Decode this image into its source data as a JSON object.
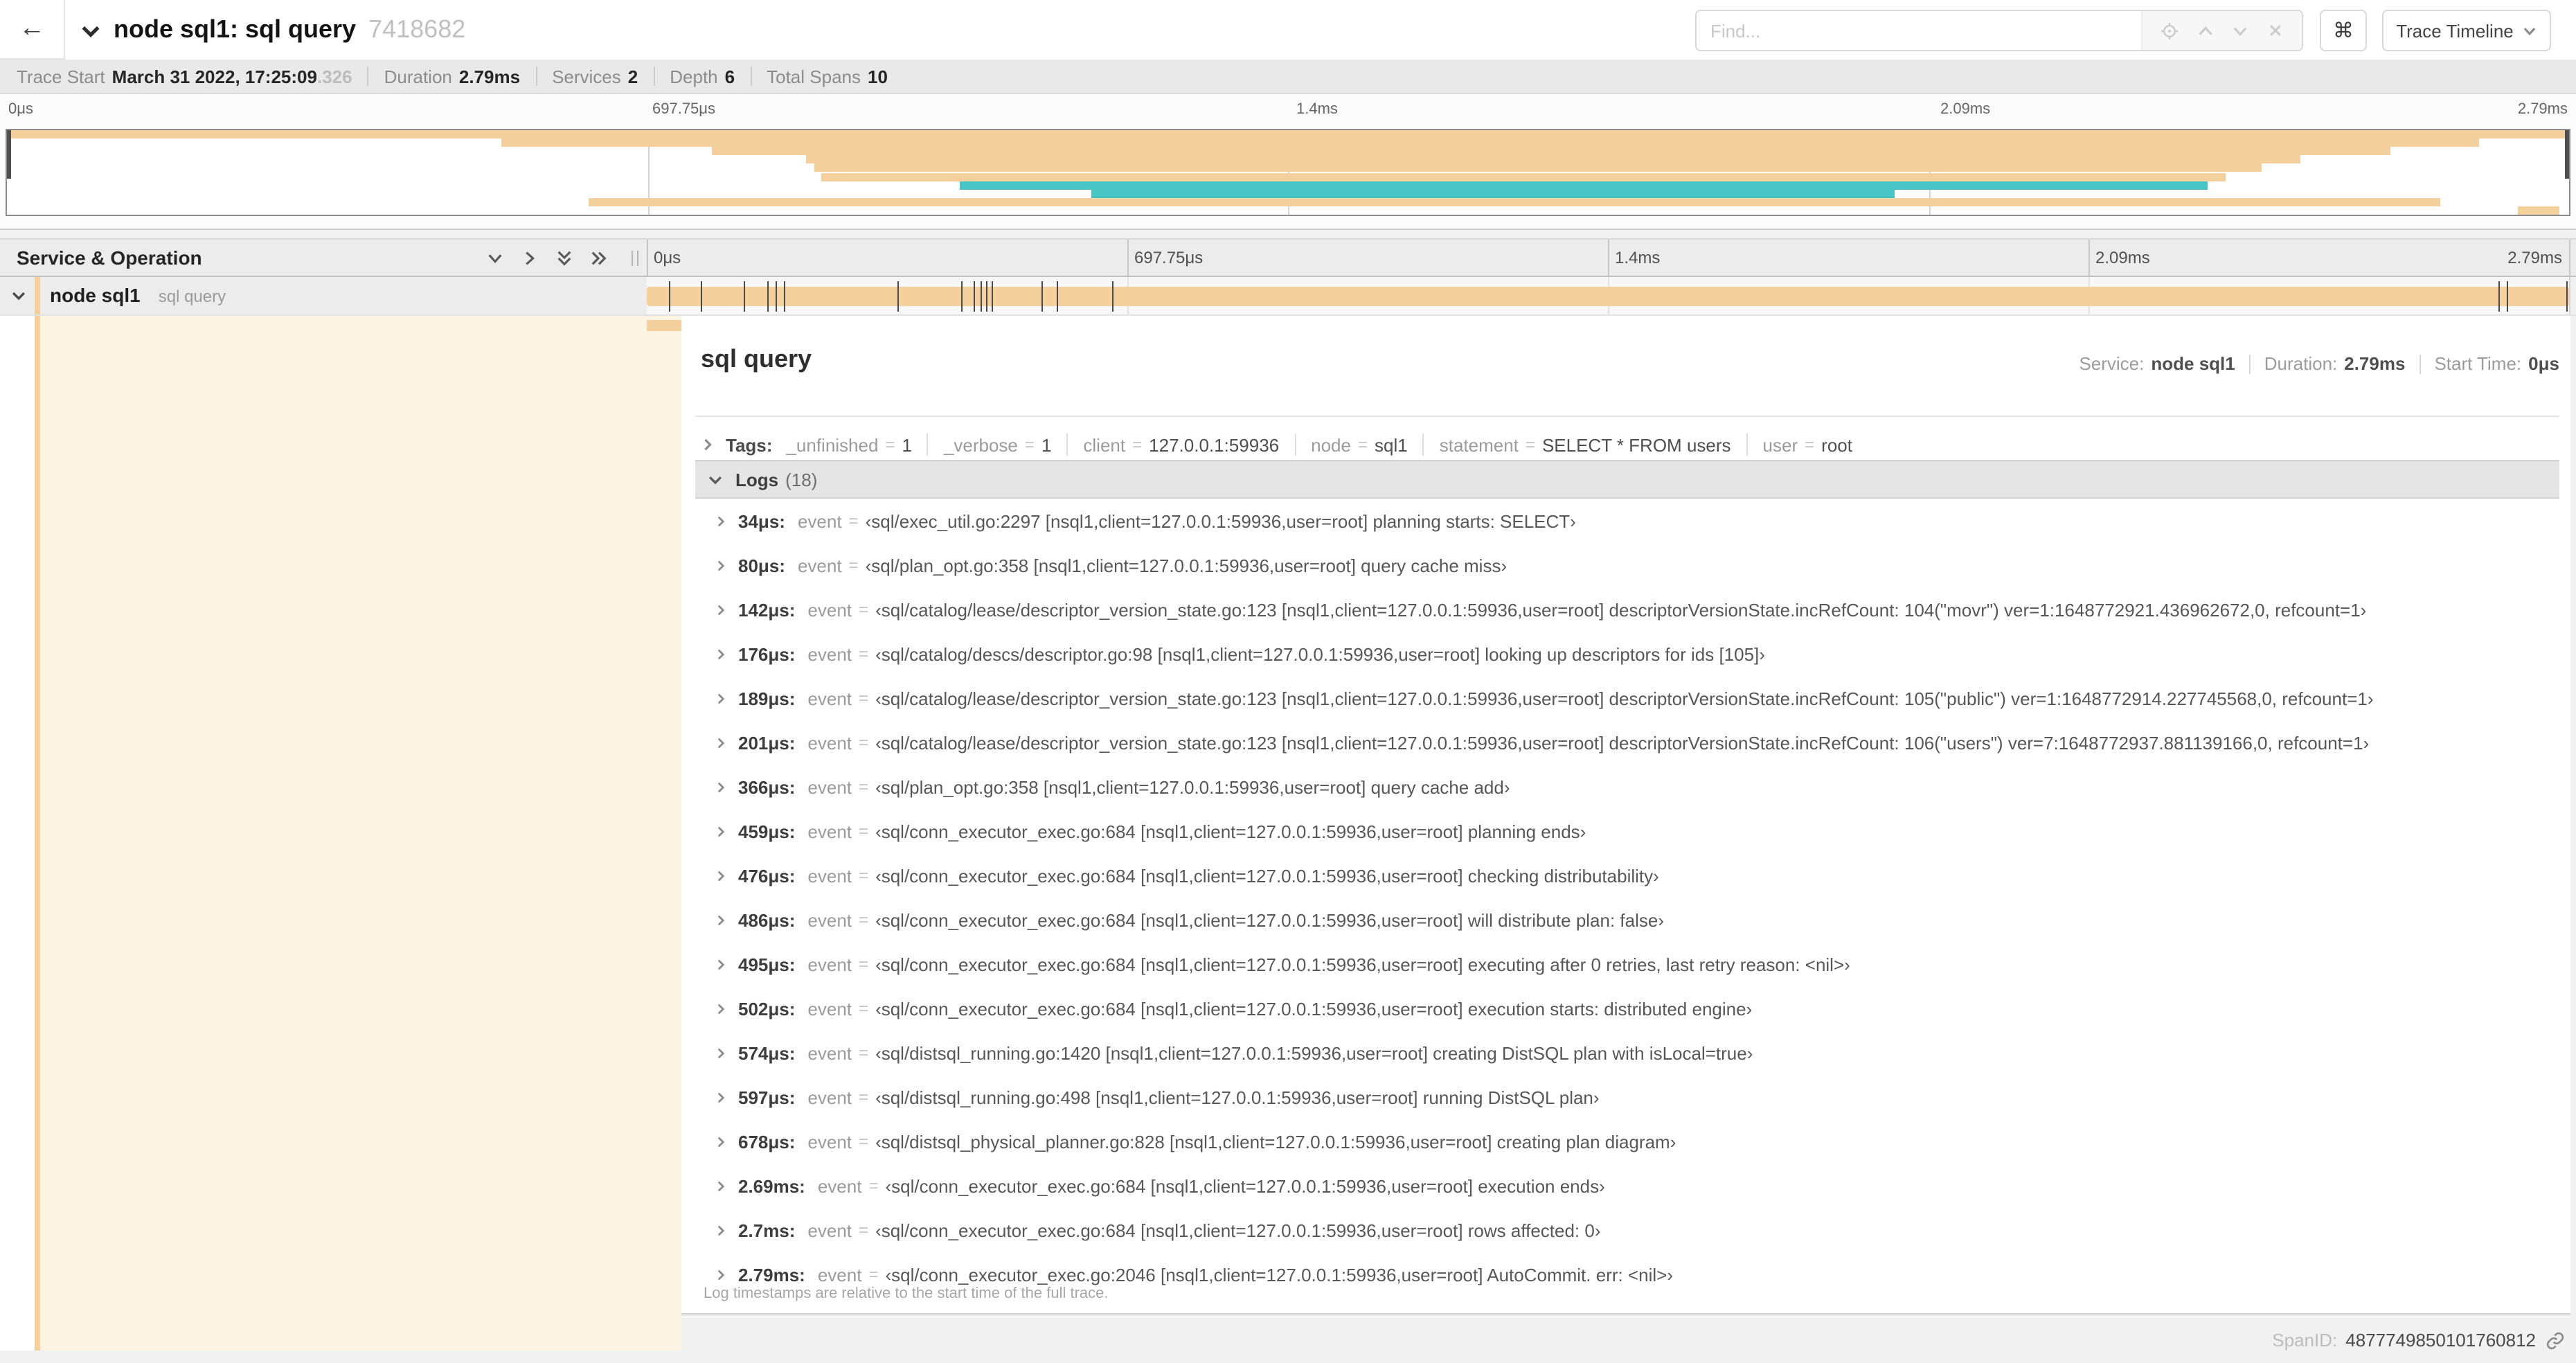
{
  "header": {
    "back_icon": "←",
    "title": "node sql1: sql query",
    "trace_id": "7418682",
    "find_placeholder": "Find...",
    "kbd_icon": "⌘",
    "view_select_label": "Trace Timeline"
  },
  "summary": {
    "items": [
      {
        "label": "Trace Start",
        "value": "March 31 2022, 17:25:09",
        "suffix": ".326"
      },
      {
        "label": "Duration",
        "value": "2.79ms"
      },
      {
        "label": "Services",
        "value": "2"
      },
      {
        "label": "Depth",
        "value": "6"
      },
      {
        "label": "Total Spans",
        "value": "10"
      }
    ]
  },
  "colors": {
    "tan": "#f4d19c",
    "teal": "#49c4c4",
    "cream": "#fcf4e3"
  },
  "timeline": {
    "left_header": "Service & Operation",
    "ticks": [
      "0μs",
      "697.75μs",
      "1.4ms",
      "2.09ms",
      "2.79ms"
    ],
    "tick_pcts": [
      0,
      25,
      50,
      75,
      100
    ],
    "row": {
      "service": "node sql1",
      "operation": "sql query",
      "bar_start_pct": 0,
      "bar_end_pct": 100,
      "log_marker_pcts": [
        1.22,
        2.87,
        5.09,
        6.31,
        6.77,
        7.2,
        13.12,
        16.45,
        17.06,
        17.42,
        17.74,
        17.99,
        20.57,
        21.4,
        24.3,
        96.4,
        96.8,
        99.9
      ]
    }
  },
  "minimap": {
    "rows": [
      {
        "start": 0,
        "end": 100,
        "color": "tan"
      },
      {
        "start": 19.3,
        "end": 96.5,
        "color": "tan"
      },
      {
        "start": 27.5,
        "end": 93.0,
        "color": "tan"
      },
      {
        "start": 31.2,
        "end": 89.5,
        "color": "tan"
      },
      {
        "start": 31.5,
        "end": 88.0,
        "color": "tan"
      },
      {
        "start": 31.8,
        "end": 86.6,
        "color": "tan"
      },
      {
        "start": 37.2,
        "end": 85.9,
        "color": "teal"
      },
      {
        "start": 42.3,
        "end": 73.7,
        "color": "teal"
      },
      {
        "start": 22.7,
        "end": 95.0,
        "color": "tan"
      },
      {
        "start": 98.0,
        "end": 99.6,
        "color": "tan"
      }
    ]
  },
  "detail": {
    "title": "sql query",
    "meta": [
      {
        "label": "Service:",
        "value": "node sql1"
      },
      {
        "label": "Duration:",
        "value": "2.79ms"
      },
      {
        "label": "Start Time:",
        "value": "0μs"
      }
    ],
    "tags_label": "Tags:",
    "tags": [
      {
        "key": "_unfinished",
        "value": "1"
      },
      {
        "key": "_verbose",
        "value": "1"
      },
      {
        "key": "client",
        "value": "127.0.0.1:59936"
      },
      {
        "key": "node",
        "value": "sql1"
      },
      {
        "key": "statement",
        "value": "SELECT * FROM users"
      },
      {
        "key": "user",
        "value": "root"
      }
    ],
    "logs_label": "Logs",
    "logs_count": "(18)",
    "logs": [
      {
        "time": "34μs:",
        "key": "event",
        "value": "‹sql/exec_util.go:2297 [nsql1,client=127.0.0.1:59936,user=root] planning starts: SELECT›"
      },
      {
        "time": "80μs:",
        "key": "event",
        "value": "‹sql/plan_opt.go:358 [nsql1,client=127.0.0.1:59936,user=root] query cache miss›"
      },
      {
        "time": "142μs:",
        "key": "event",
        "value": "‹sql/catalog/lease/descriptor_version_state.go:123 [nsql1,client=127.0.0.1:59936,user=root] descriptorVersionState.incRefCount: 104(\"movr\") ver=1:1648772921.436962672,0, refcount=1›"
      },
      {
        "time": "176μs:",
        "key": "event",
        "value": "‹sql/catalog/descs/descriptor.go:98 [nsql1,client=127.0.0.1:59936,user=root] looking up descriptors for ids [105]›"
      },
      {
        "time": "189μs:",
        "key": "event",
        "value": "‹sql/catalog/lease/descriptor_version_state.go:123 [nsql1,client=127.0.0.1:59936,user=root] descriptorVersionState.incRefCount: 105(\"public\") ver=1:1648772914.227745568,0, refcount=1›"
      },
      {
        "time": "201μs:",
        "key": "event",
        "value": "‹sql/catalog/lease/descriptor_version_state.go:123 [nsql1,client=127.0.0.1:59936,user=root] descriptorVersionState.incRefCount: 106(\"users\") ver=7:1648772937.881139166,0, refcount=1›"
      },
      {
        "time": "366μs:",
        "key": "event",
        "value": "‹sql/plan_opt.go:358 [nsql1,client=127.0.0.1:59936,user=root] query cache add›"
      },
      {
        "time": "459μs:",
        "key": "event",
        "value": "‹sql/conn_executor_exec.go:684 [nsql1,client=127.0.0.1:59936,user=root] planning ends›"
      },
      {
        "time": "476μs:",
        "key": "event",
        "value": "‹sql/conn_executor_exec.go:684 [nsql1,client=127.0.0.1:59936,user=root] checking distributability›"
      },
      {
        "time": "486μs:",
        "key": "event",
        "value": "‹sql/conn_executor_exec.go:684 [nsql1,client=127.0.0.1:59936,user=root] will distribute plan: false›"
      },
      {
        "time": "495μs:",
        "key": "event",
        "value": "‹sql/conn_executor_exec.go:684 [nsql1,client=127.0.0.1:59936,user=root] executing after 0 retries, last retry reason: <nil>›"
      },
      {
        "time": "502μs:",
        "key": "event",
        "value": "‹sql/conn_executor_exec.go:684 [nsql1,client=127.0.0.1:59936,user=root] execution starts: distributed engine›"
      },
      {
        "time": "574μs:",
        "key": "event",
        "value": "‹sql/distsql_running.go:1420 [nsql1,client=127.0.0.1:59936,user=root] creating DistSQL plan with isLocal=true›"
      },
      {
        "time": "597μs:",
        "key": "event",
        "value": "‹sql/distsql_running.go:498 [nsql1,client=127.0.0.1:59936,user=root] running DistSQL plan›"
      },
      {
        "time": "678μs:",
        "key": "event",
        "value": "‹sql/distsql_physical_planner.go:828 [nsql1,client=127.0.0.1:59936,user=root] creating plan diagram›"
      },
      {
        "time": "2.69ms:",
        "key": "event",
        "value": "‹sql/conn_executor_exec.go:684 [nsql1,client=127.0.0.1:59936,user=root] execution ends›"
      },
      {
        "time": "2.7ms:",
        "key": "event",
        "value": "‹sql/conn_executor_exec.go:684 [nsql1,client=127.0.0.1:59936,user=root] rows affected: 0›"
      },
      {
        "time": "2.79ms:",
        "key": "event",
        "value": "‹sql/conn_executor_exec.go:2046 [nsql1,client=127.0.0.1:59936,user=root] AutoCommit. err: <nil>›"
      }
    ],
    "note": "Log timestamps are relative to the start time of the full trace.",
    "footer": {
      "label": "SpanID:",
      "value": "4877749850101760812"
    }
  }
}
